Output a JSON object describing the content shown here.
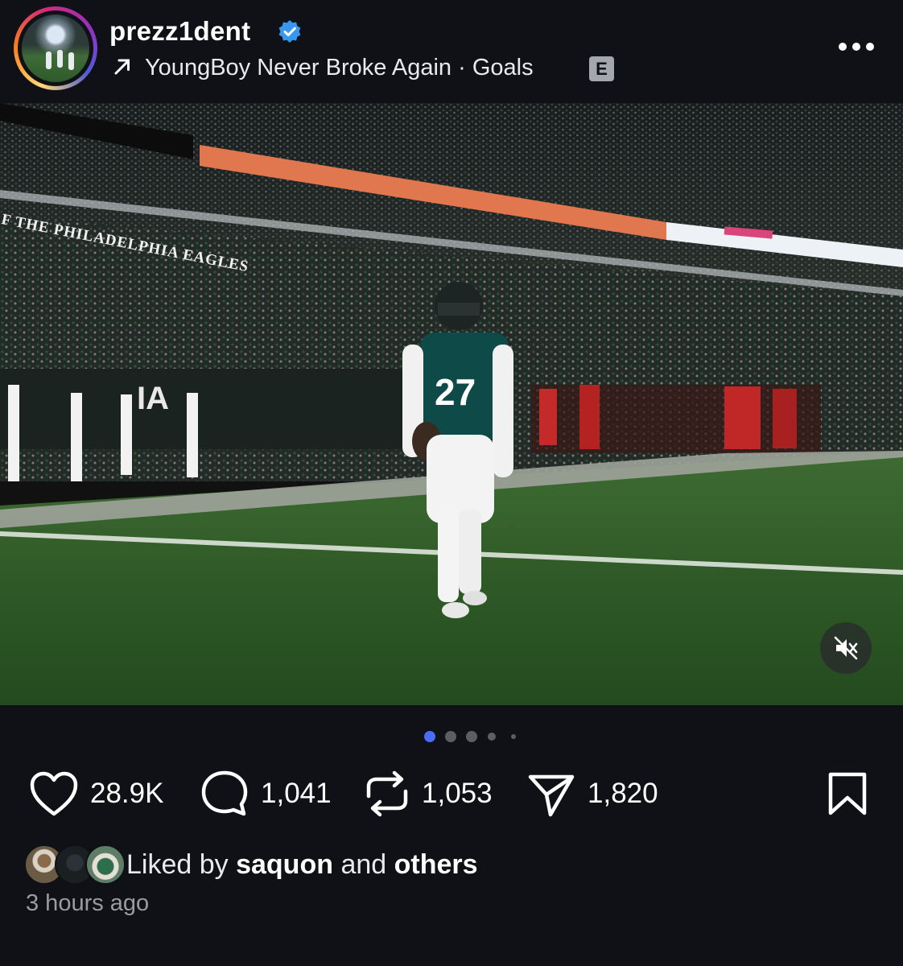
{
  "post": {
    "username": "prezz1dent",
    "verified": true,
    "music_artist": "YoungBoy Never Broke Again",
    "separator": "·",
    "music_title": "Goals",
    "explicit_badge": "E",
    "photo_sign_text": "F THE PHILADELPHIA EAGLES",
    "carousel": {
      "total": 5,
      "active_index": 0
    }
  },
  "actions": {
    "likes": "28.9K",
    "comments": "1,041",
    "reposts": "1,053",
    "shares": "1,820"
  },
  "liked_by": {
    "prefix": "Liked by",
    "user": "saquon",
    "conjunction": "and",
    "others": "others"
  },
  "timestamp": "3 hours ago",
  "icons": {
    "verified": "verified-badge-icon",
    "music": "arrow-up-right-icon",
    "more": "more-horizontal-icon",
    "mute": "speaker-muted-icon",
    "like": "heart-icon",
    "comment": "comment-bubble-icon",
    "repost": "repost-icon",
    "share": "send-icon",
    "save": "bookmark-icon"
  },
  "colors": {
    "background": "#0f1116",
    "verified_blue": "#3897f0",
    "active_dot": "#4a6cf7",
    "text_secondary": "#9a9ca2"
  }
}
